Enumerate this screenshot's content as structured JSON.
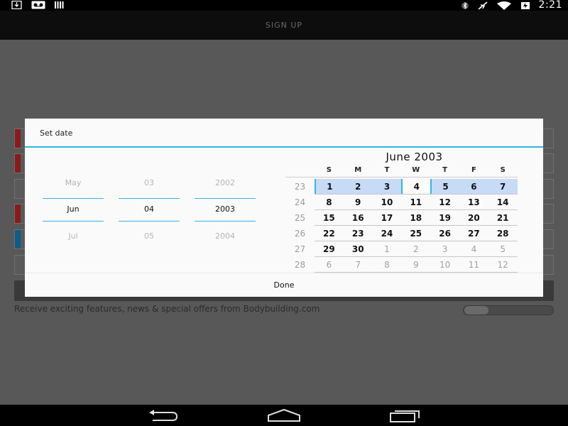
{
  "status_bar": {
    "time": "2:21",
    "left_icons": [
      "download-icon",
      "voicemail-icon",
      "barcode-icon"
    ],
    "right_icons": [
      "bluetooth-icon",
      "airplane-icon",
      "wifi-icon",
      "battery-icon"
    ]
  },
  "action_bar": {
    "title": "SIGN UP"
  },
  "background_form": {
    "optin_label": "Receive exciting features, news & special offers from Bodybuilding.com"
  },
  "dialog": {
    "title": "Set date",
    "month_spinner": {
      "prev": "May",
      "current": "Jun",
      "next": "Jul"
    },
    "day_spinner": {
      "prev": "03",
      "current": "04",
      "next": "05"
    },
    "year_spinner": {
      "prev": "2002",
      "current": "2003",
      "next": "2004"
    },
    "calendar": {
      "title": "June 2003",
      "weekday_headers": [
        "S",
        "M",
        "T",
        "W",
        "T",
        "F",
        "S"
      ],
      "weeks": [
        {
          "week": "23",
          "days": [
            "1",
            "2",
            "3",
            "4",
            "5",
            "6",
            "7"
          ]
        },
        {
          "week": "24",
          "days": [
            "8",
            "9",
            "10",
            "11",
            "12",
            "13",
            "14"
          ]
        },
        {
          "week": "25",
          "days": [
            "15",
            "16",
            "17",
            "18",
            "19",
            "20",
            "21"
          ]
        },
        {
          "week": "26",
          "days": [
            "22",
            "23",
            "24",
            "25",
            "26",
            "27",
            "28"
          ]
        },
        {
          "week": "27",
          "days": [
            "29",
            "30",
            "1",
            "2",
            "3",
            "4",
            "5"
          ]
        },
        {
          "week": "28",
          "days": [
            "6",
            "7",
            "8",
            "9",
            "10",
            "11",
            "12"
          ]
        }
      ]
    },
    "done_label": "Done"
  },
  "colors": {
    "accent": "#33b5e5",
    "selected_week": "#c7dbf7",
    "red_marker": "#8b1a1a",
    "blue_marker": "#0b5d8a"
  },
  "nav_icons": [
    "back-icon",
    "home-icon",
    "recent-apps-icon"
  ]
}
